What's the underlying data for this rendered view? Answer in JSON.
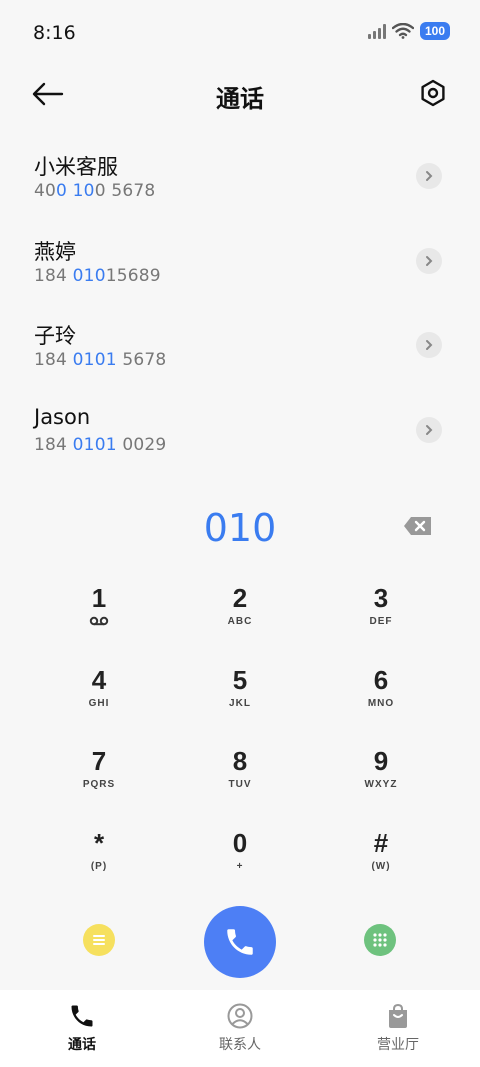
{
  "status_bar": {
    "time": "8:16",
    "battery": "100",
    "icons": [
      "signal-icon",
      "wifi-icon",
      "battery-icon"
    ]
  },
  "header": {
    "title": "通话",
    "back_icon": "arrow-left-icon",
    "settings_icon": "hexagon-settings-icon"
  },
  "contacts": [
    {
      "name": "小米客服",
      "number_parts": [
        {
          "t": "40",
          "hl": false
        },
        {
          "t": "0 10",
          "hl": true
        },
        {
          "t": "0 5678",
          "hl": false
        }
      ]
    },
    {
      "name": "燕婷",
      "number_parts": [
        {
          "t": "184 ",
          "hl": false
        },
        {
          "t": "010",
          "hl": true
        },
        {
          "t": "15689",
          "hl": false
        }
      ]
    },
    {
      "name": "子玲",
      "number_parts": [
        {
          "t": "184 ",
          "hl": false
        },
        {
          "t": "0101",
          "hl": true
        },
        {
          "t": " 5678",
          "hl": false
        }
      ]
    },
    {
      "name": "Jason",
      "number_parts": [
        {
          "t": "184 ",
          "hl": false
        },
        {
          "t": "0101",
          "hl": true
        },
        {
          "t": " 0029",
          "hl": false
        }
      ]
    }
  ],
  "dialer": {
    "input": "010",
    "keys": [
      {
        "digit": "1",
        "sub": "",
        "sub_icon": "voicemail-icon"
      },
      {
        "digit": "2",
        "sub": "ABC"
      },
      {
        "digit": "3",
        "sub": "DEF"
      },
      {
        "digit": "4",
        "sub": "GHI"
      },
      {
        "digit": "5",
        "sub": "JKL"
      },
      {
        "digit": "6",
        "sub": "MNO"
      },
      {
        "digit": "7",
        "sub": "PQRS"
      },
      {
        "digit": "8",
        "sub": "TUV"
      },
      {
        "digit": "9",
        "sub": "WXYZ"
      },
      {
        "digit": "*",
        "sub": "(P)"
      },
      {
        "digit": "0",
        "sub": "+"
      },
      {
        "digit": "#",
        "sub": "(W)"
      }
    ]
  },
  "actions": {
    "menu_icon": "menu-icon",
    "call_icon": "phone-icon",
    "keypad_icon": "dialpad-icon"
  },
  "colors": {
    "accent": "#3a7cf0",
    "call": "#4d7ff5",
    "menu": "#f6e05e",
    "keypad": "#6ec27e"
  },
  "bottom_nav": [
    {
      "label": "通话",
      "icon": "phone-icon",
      "active": true
    },
    {
      "label": "联系人",
      "icon": "contact-icon",
      "active": false
    },
    {
      "label": "营业厅",
      "icon": "shopping-bag-icon",
      "active": false
    }
  ]
}
